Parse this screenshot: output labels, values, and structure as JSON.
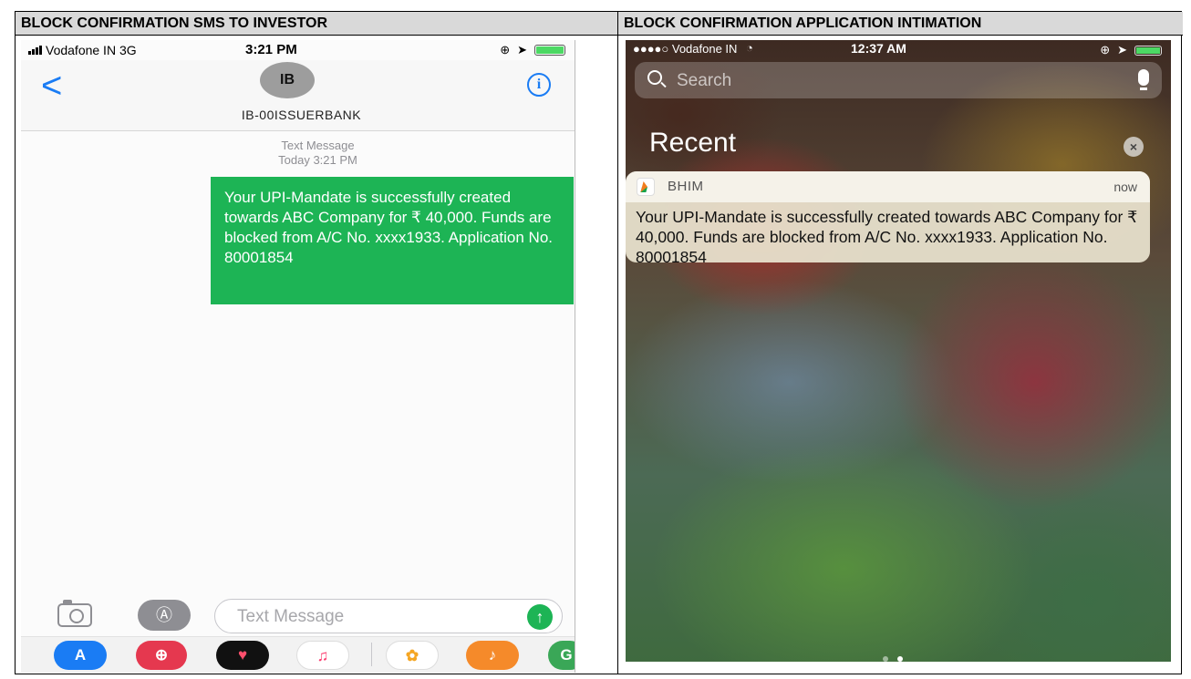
{
  "headers": {
    "left": "BLOCK CONFIRMATION SMS TO INVESTOR",
    "right": "BLOCK CONFIRMATION APPLICATION INTIMATION"
  },
  "sms_screen": {
    "status": {
      "carrier": "Vodafone IN  3G",
      "time": "3:21 PM"
    },
    "nav": {
      "back": "<",
      "avatar": "IB",
      "sender": "IB-00ISSUERBANK",
      "info": "i"
    },
    "meta": {
      "type": "Text Message",
      "when": "Today 3:21 PM"
    },
    "message": "Your UPI-Mandate is successfully created towards ABC Company for ₹ 40,000. Funds are blocked from A/C No. xxxx1933. Application No. 80001854",
    "input": {
      "placeholder": "Text Message",
      "send": "↑"
    },
    "colors": {
      "bubble": "#1db455",
      "accent": "#1a7cf4"
    },
    "dock_icons": [
      "app-store-icon",
      "search-globe-icon",
      "heart-icon",
      "music-icon",
      "photos-icon",
      "garageband-icon",
      "maps-icon"
    ]
  },
  "notification_screen": {
    "status": {
      "carrier": "●●●●○ Vodafone IN",
      "time": "12:37 AM"
    },
    "search_placeholder": "Search",
    "section_title": "Recent",
    "clear": "×",
    "notification": {
      "app": "BHIM",
      "time": "now",
      "body": "Your UPI-Mandate is successfully created towards ABC Company for ₹ 40,000. Funds are blocked from A/C No. xxxx1933. Application No. 80001854"
    }
  }
}
